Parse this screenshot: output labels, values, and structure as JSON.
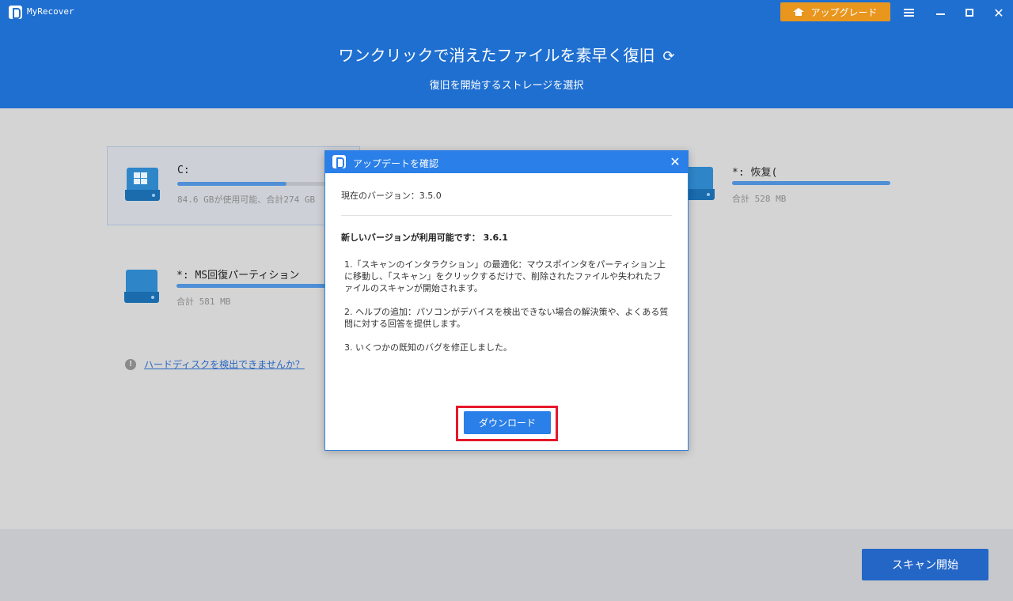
{
  "app": {
    "title": "MyRecover",
    "upgrade_label": "アップグレード"
  },
  "header": {
    "headline": "ワンクリックで消えたファイルを素早く復旧",
    "subline": "復旧を開始するストレージを選択"
  },
  "drives": [
    {
      "name": "C:",
      "info": "84.6 GBが使用可能、合計274 GB",
      "used_fraction": 0.69,
      "selected": true,
      "icon": "windows-drive-icon"
    },
    {
      "name": "*: 恢复(",
      "info": "合計 528 MB",
      "used_fraction": 1.0,
      "selected": false,
      "icon": "drive-icon"
    },
    {
      "name": "*: MS回復パーティション",
      "info": "合計 581 MB",
      "used_fraction": 1.0,
      "selected": false,
      "icon": "drive-icon"
    }
  ],
  "help": {
    "link_text": "ハードディスクを検出できませんか？"
  },
  "footer": {
    "scan_label": "スキャン開始"
  },
  "dialog": {
    "title": "アップデートを確認",
    "current_version": "現在のバージョン：3.5.0",
    "new_version": "新しいバージョンが利用可能です： 3.6.1",
    "notes": [
      "1.「スキャンのインタラクション」の最適化：マウスポインタをパーティション上に移動し、「スキャン」をクリックするだけで、削除されたファイルや失われたファイルのスキャンが開始されます。",
      "2. ヘルプの追加：パソコンがデバイスを検出できない場合の解決策や、よくある質問に対する回答を提供します。",
      "3. いくつかの既知のバグを修正しました。"
    ],
    "download_label": "ダウンロード"
  },
  "colors": {
    "header_blue": "#1f6fd0",
    "upgrade_orange": "#e8961e",
    "dialog_blue": "#2a7fe8",
    "highlight_red": "#e5182a",
    "scan_blue": "#2366c6"
  }
}
